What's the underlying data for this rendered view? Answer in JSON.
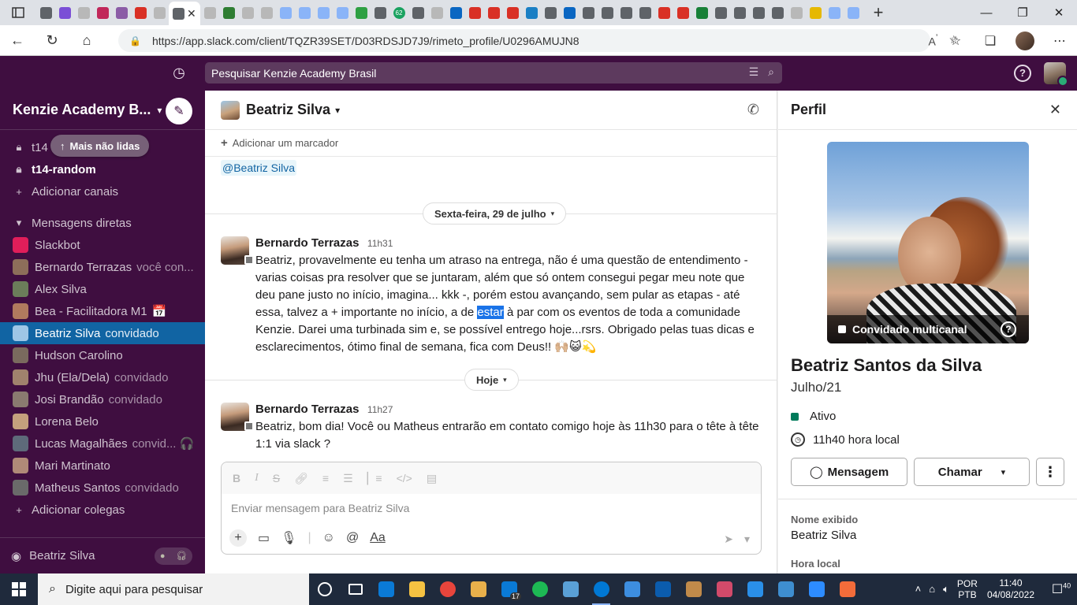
{
  "browser": {
    "url": "https://app.slack.com/client/TQZR39SET/D03RDSJD7J9/rimeto_profile/U0296AMUJN8",
    "tab_badge": "62",
    "tab_favicon_colors": [
      "#5f6368",
      "#7b4fd6",
      "#b8b8b8",
      "#c1275a",
      "#8b5ca6",
      "#d93025",
      "#b8b8b8",
      "#5f6368",
      "#b8b8b8",
      "#2e7d32",
      "#b8b8b8",
      "#b8b8b8",
      "#8ab4f8",
      "#8ab4f8",
      "#8ab4f8",
      "#8ab4f8",
      "#2ea043",
      "#5f6368",
      "#1aa260",
      "#5f6368",
      "#b8b8b8",
      "#0a66c2",
      "#d93025",
      "#d93025",
      "#d93025",
      "#1b7fc4",
      "#5f6368",
      "#0a66c2",
      "#5f6368",
      "#5f6368",
      "#5f6368",
      "#5f6368",
      "#d93025",
      "#d93025",
      "#188038",
      "#5f6368",
      "#5f6368",
      "#5f6368",
      "#5f6368",
      "#b8b8b8",
      "#e6b800",
      "#8ab4f8",
      "#8ab4f8"
    ]
  },
  "slack_top": {
    "search_placeholder": "Pesquisar Kenzie Academy Brasil"
  },
  "sidebar": {
    "workspace": "Kenzie Academy B...",
    "more_unread": "Mais não lidas",
    "channels": [
      {
        "name": "t14",
        "bold": false
      },
      {
        "name": "t14-random",
        "bold": true
      }
    ],
    "add_channels": "Adicionar canais",
    "dm_section": "Mensagens diretas",
    "dms": [
      {
        "name": "Slackbot",
        "note": "",
        "color": "#e01e5a"
      },
      {
        "name": "Bernardo Terrazas",
        "note": "você  con...",
        "color": "#8d6e5a"
      },
      {
        "name": "Alex Silva",
        "note": "",
        "color": "#6b7d5a"
      },
      {
        "name": "Bea - Facilitadora M1",
        "note": "📅",
        "color": "#b07a5e"
      },
      {
        "name": "Beatriz Silva",
        "note": "convidado",
        "color": "#9ec6e6",
        "selected": true
      },
      {
        "name": "Hudson Carolino",
        "note": "",
        "color": "#7a6a5e"
      },
      {
        "name": "Jhu (Ela/Dela)",
        "note": "convidado",
        "color": "#a0826d"
      },
      {
        "name": "Josi Brandão",
        "note": "convidado",
        "color": "#8a7a70"
      },
      {
        "name": "Lorena Belo",
        "note": "",
        "color": "#c4a07d"
      },
      {
        "name": "Lucas Magalhães",
        "note": "convid...  🎧",
        "color": "#5e6a7a"
      },
      {
        "name": "Mari Martinato",
        "note": "",
        "color": "#b08a78"
      },
      {
        "name": "Matheus Santos",
        "note": "convidado",
        "color": "#6a6a6a"
      }
    ],
    "add_colleagues": "Adicionar colegas",
    "footer_name": "Beatriz Silva"
  },
  "channel": {
    "title": "Beatriz Silva",
    "add_bookmark": "Adicionar um marcador",
    "mention": "@Beatriz Silva",
    "date1": "Sexta-feira, 29 de julho",
    "date2": "Hoje",
    "msg1": {
      "author": "Bernardo Terrazas",
      "time": "11h31",
      "text_before": "Beatriz, provavelmente eu tenha um atraso na entrega, não é uma questão de entendimento - varias coisas pra resolver que se juntaram, além que só ontem consegui pegar meu note que deu pane justo no início, imagina... kkk -, porém estou avançando, sem  pular as etapas - até essa, talvez a + importante no início, a de ",
      "highlight": "estar",
      "text_after": " à par com os eventos de toda a comunidade Kenzie. Darei uma turbinada sim e, se possível entrego hoje...rsrs. Obrigado pelas tuas dicas e esclarecimentos, ótimo final de semana, fica com Deus!! 🙌🏼😺💫"
    },
    "msg2": {
      "author": "Bernardo Terrazas",
      "time": "11h27",
      "text": "Beatriz, bom dia! Você ou Matheus entrarão em contato comigo hoje às 11h30 para o tête à tête 1:1 via slack ?"
    },
    "composer_placeholder": "Enviar mensagem para Beatriz Silva"
  },
  "profile": {
    "title": "Perfil",
    "badge": "Convidado multicanal",
    "full_name": "Beatriz Santos da Silva",
    "subtitle": "Julho/21",
    "status": "Ativo",
    "local_time": "11h40 hora local",
    "btn_message": "Mensagem",
    "btn_call": "Chamar",
    "display_name_label": "Nome exibido",
    "display_name": "Beatriz Silva",
    "local_time_label": "Hora local"
  },
  "taskbar": {
    "search_placeholder": "Digite aqui para pesquisar",
    "lang1": "POR",
    "lang2": "PTB",
    "time": "11:40",
    "date": "04/08/2022",
    "mail_badge": "17",
    "notif_count": "40",
    "app_colors": [
      "#ffffff",
      "#ffffff",
      "#0a7ad6",
      "#f5c242",
      "#e8453c",
      "#e8b04b",
      "#0a7ad6",
      "#1db954",
      "#5aa0d6",
      "#0078d4",
      "#3d8ee0",
      "#0b5cad",
      "#c08a4a",
      "#d24a6a",
      "#2a8fe8",
      "#3e8ed0",
      "#2d8cff",
      "#f26c3a"
    ]
  }
}
